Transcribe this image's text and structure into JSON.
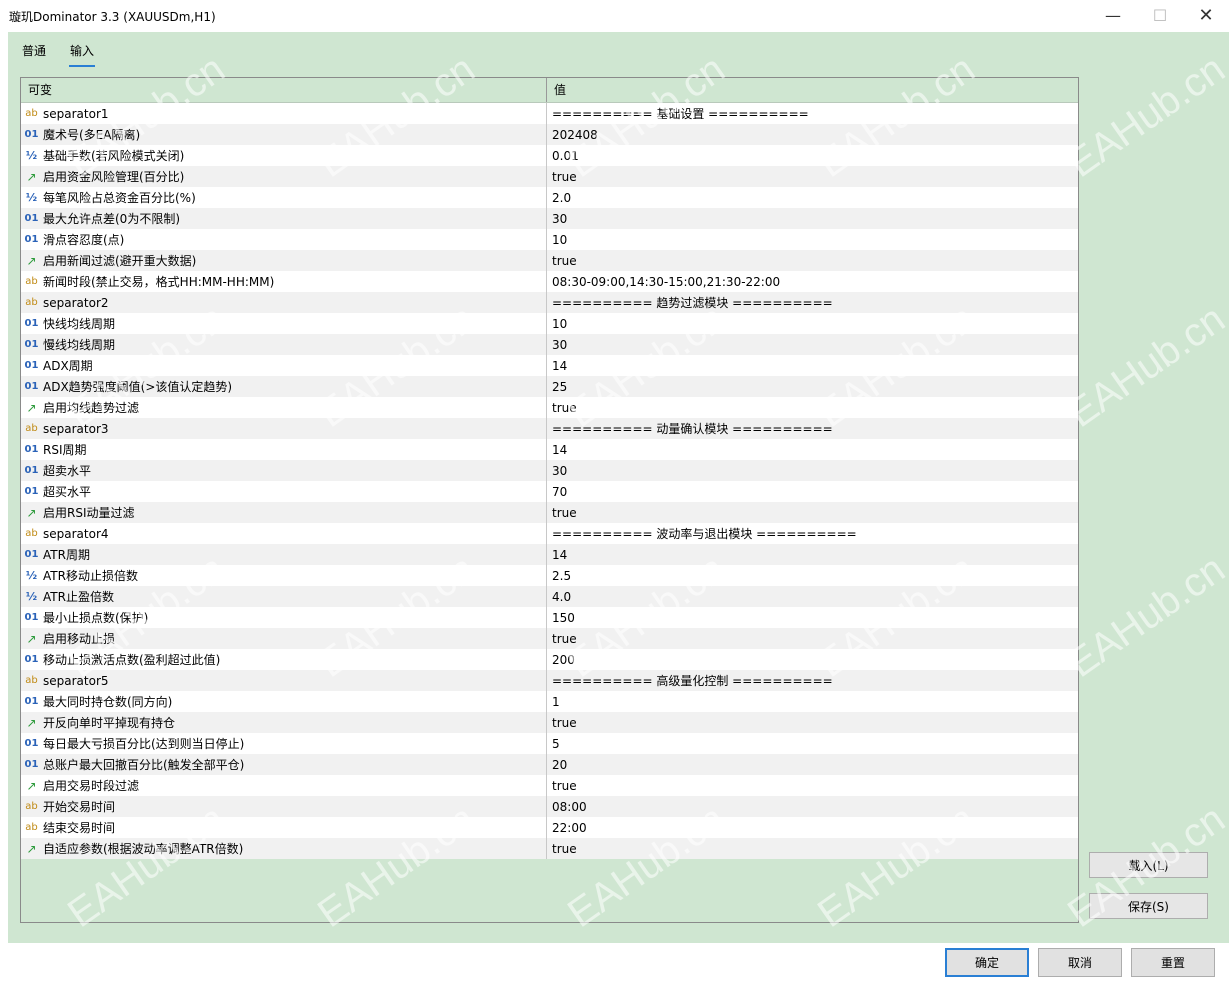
{
  "window": {
    "title": "璇玑Dominator 3.3 (XAUUSDm,H1)",
    "min_icon": "—",
    "max_icon": "☐",
    "close_icon": "✕"
  },
  "tabs": [
    {
      "label": "普通"
    },
    {
      "label": "输入",
      "active": true
    }
  ],
  "grid": {
    "col_name": "可变",
    "col_value": "值",
    "rows": [
      {
        "type": "ab",
        "icon": "ab",
        "name": "separator1",
        "value": "========== 基础设置 =========="
      },
      {
        "type": "01",
        "icon": "01",
        "name": "魔术号(多EA隔离)",
        "value": "202408"
      },
      {
        "type": "half",
        "icon": "½",
        "name": "基础手数(若风险模式关闭)",
        "value": "0.01"
      },
      {
        "type": "bool",
        "icon": "↗",
        "name": "启用资金风险管理(百分比)",
        "value": "true"
      },
      {
        "type": "half",
        "icon": "½",
        "name": "每笔风险占总资金百分比(%)",
        "value": "2.0"
      },
      {
        "type": "01",
        "icon": "01",
        "name": "最大允许点差(0为不限制)",
        "value": "30"
      },
      {
        "type": "01",
        "icon": "01",
        "name": "滑点容忍度(点)",
        "value": "10"
      },
      {
        "type": "bool",
        "icon": "↗",
        "name": "启用新闻过滤(避开重大数据)",
        "value": "true"
      },
      {
        "type": "ab",
        "icon": "ab",
        "name": "新闻时段(禁止交易，格式HH:MM-HH:MM)",
        "value": "08:30-09:00,14:30-15:00,21:30-22:00"
      },
      {
        "type": "ab",
        "icon": "ab",
        "name": "separator2",
        "value": "========== 趋势过滤模块 =========="
      },
      {
        "type": "01",
        "icon": "01",
        "name": "快线均线周期",
        "value": "10"
      },
      {
        "type": "01",
        "icon": "01",
        "name": "慢线均线周期",
        "value": "30"
      },
      {
        "type": "01",
        "icon": "01",
        "name": "ADX周期",
        "value": "14"
      },
      {
        "type": "01",
        "icon": "01",
        "name": "ADX趋势强度阈值(>该值认定趋势)",
        "value": "25"
      },
      {
        "type": "bool",
        "icon": "↗",
        "name": "启用均线趋势过滤",
        "value": "true"
      },
      {
        "type": "ab",
        "icon": "ab",
        "name": "separator3",
        "value": "========== 动量确认模块 =========="
      },
      {
        "type": "01",
        "icon": "01",
        "name": "RSI周期",
        "value": "14"
      },
      {
        "type": "01",
        "icon": "01",
        "name": "超卖水平",
        "value": "30"
      },
      {
        "type": "01",
        "icon": "01",
        "name": "超买水平",
        "value": "70"
      },
      {
        "type": "bool",
        "icon": "↗",
        "name": "启用RSI动量过滤",
        "value": "true"
      },
      {
        "type": "ab",
        "icon": "ab",
        "name": "separator4",
        "value": "========== 波动率与退出模块 =========="
      },
      {
        "type": "01",
        "icon": "01",
        "name": "ATR周期",
        "value": "14"
      },
      {
        "type": "half",
        "icon": "½",
        "name": "ATR移动止损倍数",
        "value": "2.5"
      },
      {
        "type": "half",
        "icon": "½",
        "name": "ATR止盈倍数",
        "value": "4.0"
      },
      {
        "type": "01",
        "icon": "01",
        "name": "最小止损点数(保护)",
        "value": "150"
      },
      {
        "type": "bool",
        "icon": "↗",
        "name": "启用移动止损",
        "value": "true"
      },
      {
        "type": "01",
        "icon": "01",
        "name": "移动止损激活点数(盈利超过此值)",
        "value": "200"
      },
      {
        "type": "ab",
        "icon": "ab",
        "name": "separator5",
        "value": "========== 高级量化控制 =========="
      },
      {
        "type": "01",
        "icon": "01",
        "name": "最大同时持仓数(同方向)",
        "value": "1"
      },
      {
        "type": "bool",
        "icon": "↗",
        "name": "开反向单时平掉现有持仓",
        "value": "true"
      },
      {
        "type": "01",
        "icon": "01",
        "name": "每日最大亏损百分比(达到则当日停止)",
        "value": "5"
      },
      {
        "type": "01",
        "icon": "01",
        "name": "总账户最大回撤百分比(触发全部平仓)",
        "value": "20"
      },
      {
        "type": "bool",
        "icon": "↗",
        "name": "启用交易时段过滤",
        "value": "true"
      },
      {
        "type": "ab",
        "icon": "ab",
        "name": "开始交易时间",
        "value": "08:00"
      },
      {
        "type": "ab",
        "icon": "ab",
        "name": "结束交易时间",
        "value": "22:00"
      },
      {
        "type": "bool",
        "icon": "↗",
        "name": "自适应参数(根据波动率调整ATR倍数)",
        "value": "true"
      }
    ]
  },
  "side_buttons": {
    "load": "载入(L)",
    "save": "保存(S)"
  },
  "bottom_buttons": {
    "ok": "确定",
    "cancel": "取消",
    "reset": "重置"
  },
  "watermark": "EAHub.cn"
}
